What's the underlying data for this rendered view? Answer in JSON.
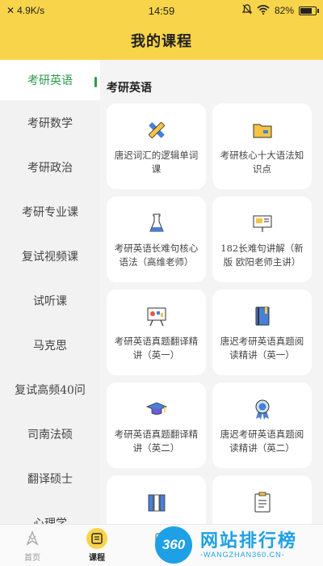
{
  "status": {
    "speed": "4.9K/s",
    "time": "14:59",
    "battery": "82%",
    "battery_level": 0.82
  },
  "header": {
    "title": "我的课程"
  },
  "sidebar": {
    "items": [
      {
        "label": "考研英语",
        "active": true
      },
      {
        "label": "考研数学"
      },
      {
        "label": "考研政治"
      },
      {
        "label": "考研专业课"
      },
      {
        "label": "复试视频课"
      },
      {
        "label": "试听课"
      },
      {
        "label": "马克思"
      },
      {
        "label": "复试高频40问"
      },
      {
        "label": "司南法硕"
      },
      {
        "label": "翻译硕士"
      },
      {
        "label": "心理学"
      }
    ]
  },
  "content": {
    "section_title": "考研英语",
    "cards": [
      {
        "title": "唐迟词汇的逻辑单词课",
        "icon": "pencil-ruler-icon"
      },
      {
        "title": "考研核心十大语法知识点",
        "icon": "folder-icon"
      },
      {
        "title": "考研英语长难句核心语法（高维老师）",
        "icon": "flask-icon"
      },
      {
        "title": "182长难句讲解（新版 欧阳老师主讲）",
        "icon": "presentation-board-icon"
      },
      {
        "title": "考研英语真题翻译精讲（英一）",
        "icon": "easel-icon"
      },
      {
        "title": "唐迟考研英语真题阅读精讲（英一）",
        "icon": "notebook-icon"
      },
      {
        "title": "考研英语真题翻译精讲（英二）",
        "icon": "graduation-cap-icon"
      },
      {
        "title": "唐迟考研英语真题阅读精讲（英二）",
        "icon": "award-medal-icon"
      },
      {
        "title": "",
        "icon": "books-icon"
      },
      {
        "title": "",
        "icon": "checklist-icon"
      }
    ]
  },
  "tabbar": {
    "tabs": [
      {
        "label": "首页",
        "icon": "home-icon"
      },
      {
        "label": "课程",
        "icon": "course-icon",
        "active": true
      },
      {
        "label": "",
        "icon": "tab-icon"
      }
    ]
  },
  "watermark": {
    "logo": "360",
    "cn": "网站排行榜",
    "en": "-WANGZHAN360.CN-"
  },
  "colors": {
    "accent": "#f8d44a",
    "active_green": "#2e9a4a",
    "icon_yellow": "#f5c542",
    "icon_blue": "#4a7fd6"
  }
}
